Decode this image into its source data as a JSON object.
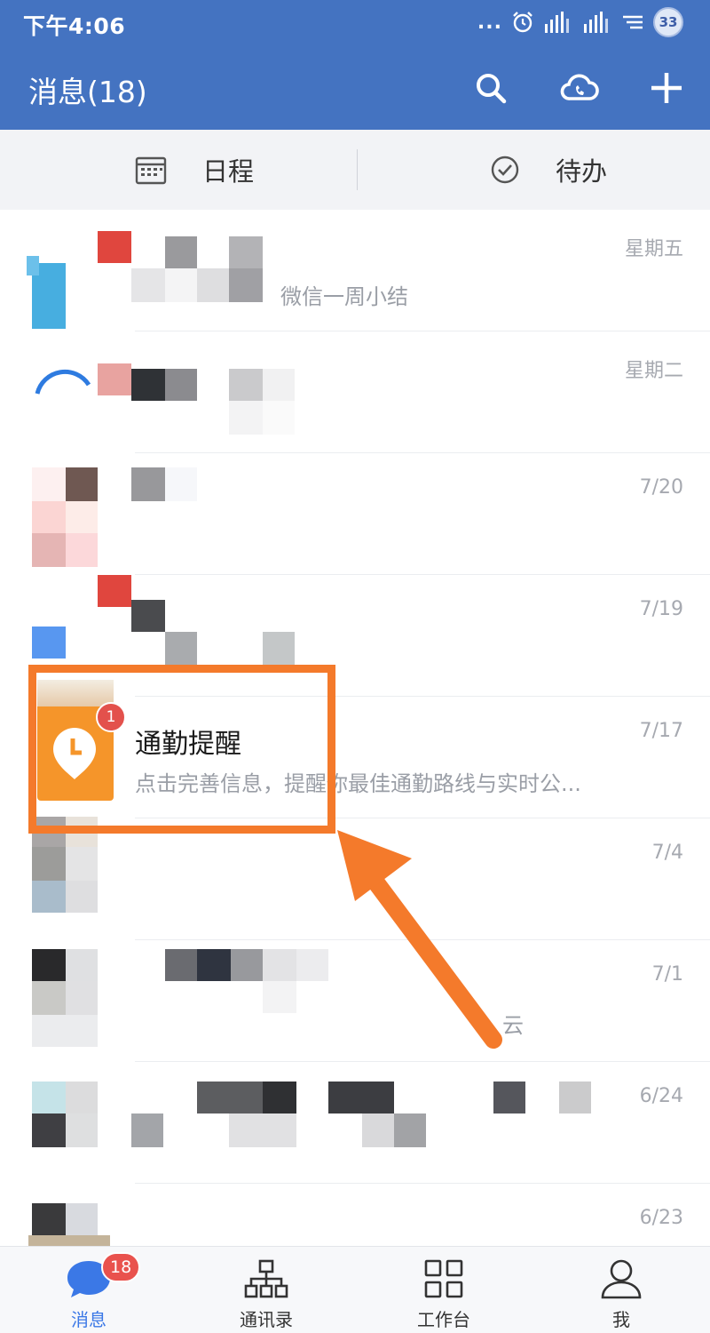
{
  "status_bar": {
    "time": "下午4:06",
    "dots": "...",
    "battery": "33"
  },
  "header": {
    "title": "消息(18)",
    "icons": [
      "search-icon",
      "cloud-phone-icon",
      "plus-icon"
    ]
  },
  "quick_tabs": [
    {
      "label": "日程",
      "icon": "calendar-icon"
    },
    {
      "label": "待办",
      "icon": "check-circle-icon"
    }
  ],
  "conversations": [
    {
      "time": "星期五",
      "name": "",
      "preview": "微信一周小结"
    },
    {
      "time": "星期二",
      "name": "",
      "preview": ""
    },
    {
      "time": "7/20",
      "name": "",
      "preview": ""
    },
    {
      "time": "7/19",
      "name": "",
      "preview": ""
    },
    {
      "time": "7/17",
      "name": "通勤提醒",
      "preview": "点击完善信息，提醒你最佳通勤路线与实时公...",
      "unread": "1"
    },
    {
      "time": "7/4",
      "name": "",
      "preview": ""
    },
    {
      "time": "7/1",
      "name": "",
      "preview": "云"
    },
    {
      "time": "6/24",
      "name": "",
      "preview": ""
    },
    {
      "time": "6/23",
      "name": "",
      "preview": ""
    }
  ],
  "bottom_nav": [
    {
      "label": "消息",
      "icon": "chat-bubble-icon",
      "badge": "18",
      "active": true
    },
    {
      "label": "通讯录",
      "icon": "org-chart-icon"
    },
    {
      "label": "工作台",
      "icon": "grid-icon"
    },
    {
      "label": "我",
      "icon": "person-icon"
    }
  ],
  "colors": {
    "header_blue": "#4473c1",
    "accent_blue": "#3b78e6",
    "badge_red": "#e9524d",
    "highlight_orange": "#f47a2b",
    "commute_orange": "#f5952a"
  }
}
